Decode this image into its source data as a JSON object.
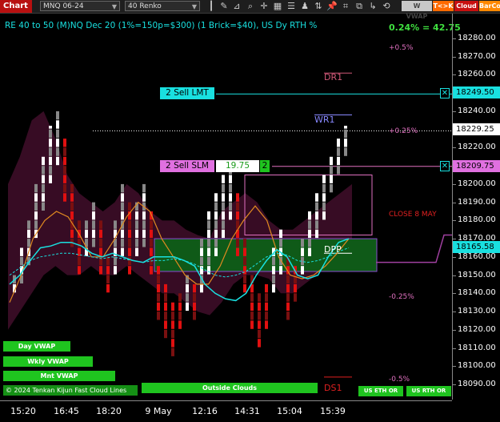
{
  "toolbar": {
    "chart_tab": "Chart",
    "instrument": "MNQ 06-24",
    "bar_type": "40 Renko",
    "btn_wvwap": "W VWAP",
    "btn_tk": "T<>K",
    "btn_cloud": "Cloud",
    "btn_barco": "BarCo"
  },
  "header": {
    "title": "RE 40 to 50 (M)NQ Dec 20 (1%=150p=$300) (1 Brick=$40), US Dy RTH %",
    "change": "0.24% = 42.75"
  },
  "y_axis": {
    "ticks": [
      "18280.00",
      "18270.00",
      "18260.00",
      "18250.00",
      "18240.00",
      "18230.00",
      "18220.00",
      "18210.00",
      "18200.00",
      "18190.00",
      "18180.00",
      "18170.00",
      "18160.00",
      "18150.00",
      "18140.00",
      "18130.00",
      "18120.00",
      "18110.00",
      "18100.00",
      "18090.00"
    ],
    "price_last": "18229.25",
    "price_lmt": "18249.50",
    "price_slm": "18209.75",
    "price_cur": "18165.58"
  },
  "x_axis": {
    "ticks": [
      "15:20",
      "16:45",
      "18:20",
      "9 May",
      "12:16",
      "14:31",
      "15:04",
      "15:39"
    ]
  },
  "levels": {
    "p05": "+0.5%",
    "dr1": "DR1",
    "wr1": "WR1",
    "p025": "+0.25%",
    "close": "CLOSE 8 MAY",
    "dpp": "DPP",
    "m025": "-0.25%",
    "m05": "-0.5%",
    "ds1": "DS1"
  },
  "orders": {
    "lmt_label": "2 Sell LMT",
    "slm_label": "2 Sell SLM",
    "slm_value": "19.75",
    "slm_qty": "2"
  },
  "indicators": {
    "day_vwap": "Day VWAP",
    "wkly_vwap": "Wkly VWAP",
    "mnt_vwap": "Mnt VWAP",
    "outside_clouds": "Outside Clouds",
    "us_eth_or": "US ETH OR",
    "us_rth_or": "US RTH OR",
    "footer_text": "© 2024 Tenkan Kijun Fast Cloud Lines"
  },
  "colors": {
    "up_brick": "#ffffff",
    "down_brick": "#e01010",
    "cyan": "#19e0e0",
    "orange": "#e08a20",
    "cloud": "#4a1030",
    "green_box": "#0f5a18",
    "pink": "#e070c0"
  },
  "chart_data": {
    "type": "renko",
    "y_range": [
      18084,
      18292
    ],
    "bricks_note": "column series",
    "columns": [
      {
        "dir": "up",
        "low": 18140,
        "high": 18150
      },
      {
        "dir": "up",
        "low": 18145,
        "high": 18165
      },
      {
        "dir": "up",
        "low": 18155,
        "high": 18180
      },
      {
        "dir": "up",
        "low": 18170,
        "high": 18200
      },
      {
        "dir": "up",
        "low": 18185,
        "high": 18215
      },
      {
        "dir": "up",
        "low": 18200,
        "high": 18232
      },
      {
        "dir": "up",
        "low": 18210,
        "high": 18240
      },
      {
        "dir": "down",
        "low": 18190,
        "high": 18225
      },
      {
        "dir": "down",
        "low": 18165,
        "high": 18200
      },
      {
        "dir": "down",
        "low": 18150,
        "high": 18180
      },
      {
        "dir": "up",
        "low": 18160,
        "high": 18180
      },
      {
        "dir": "up",
        "low": 18165,
        "high": 18190
      },
      {
        "dir": "down",
        "low": 18150,
        "high": 18180
      },
      {
        "dir": "down",
        "low": 18140,
        "high": 18160
      },
      {
        "dir": "up",
        "low": 18150,
        "high": 18180
      },
      {
        "dir": "up",
        "low": 18160,
        "high": 18200
      },
      {
        "dir": "down",
        "low": 18150,
        "high": 18190
      },
      {
        "dir": "up",
        "low": 18160,
        "high": 18190
      },
      {
        "dir": "up",
        "low": 18165,
        "high": 18200
      },
      {
        "dir": "down",
        "low": 18150,
        "high": 18185
      },
      {
        "dir": "down",
        "low": 18125,
        "high": 18155
      },
      {
        "dir": "down",
        "low": 18115,
        "high": 18145
      },
      {
        "dir": "down",
        "low": 18105,
        "high": 18135
      },
      {
        "dir": "down",
        "low": 18120,
        "high": 18140
      },
      {
        "dir": "up",
        "low": 18130,
        "high": 18150
      },
      {
        "dir": "down",
        "low": 18125,
        "high": 18145
      },
      {
        "dir": "up",
        "low": 18140,
        "high": 18170
      },
      {
        "dir": "up",
        "low": 18150,
        "high": 18185
      },
      {
        "dir": "up",
        "low": 18160,
        "high": 18195
      },
      {
        "dir": "up",
        "low": 18170,
        "high": 18205
      },
      {
        "dir": "up",
        "low": 18180,
        "high": 18210
      },
      {
        "dir": "down",
        "low": 18160,
        "high": 18195
      },
      {
        "dir": "down",
        "low": 18140,
        "high": 18170
      },
      {
        "dir": "down",
        "low": 18120,
        "high": 18150
      },
      {
        "dir": "down",
        "low": 18110,
        "high": 18140
      },
      {
        "dir": "down",
        "low": 18120,
        "high": 18145
      },
      {
        "dir": "up",
        "low": 18140,
        "high": 18165
      },
      {
        "dir": "up",
        "low": 18150,
        "high": 18175
      },
      {
        "dir": "down",
        "low": 18125,
        "high": 18160
      },
      {
        "dir": "down",
        "low": 18135,
        "high": 18155
      },
      {
        "dir": "up",
        "low": 18150,
        "high": 18170
      },
      {
        "dir": "up",
        "low": 18160,
        "high": 18185
      },
      {
        "dir": "up",
        "low": 18170,
        "high": 18195
      },
      {
        "dir": "up",
        "low": 18180,
        "high": 18205
      },
      {
        "dir": "up",
        "low": 18195,
        "high": 18215
      },
      {
        "dir": "up",
        "low": 18205,
        "high": 18225
      },
      {
        "dir": "up",
        "low": 18215,
        "high": 18232
      }
    ],
    "tenkan": [
      18145,
      18150,
      18158,
      18165,
      18166,
      18168,
      18168,
      18166,
      18162,
      18160,
      18162,
      18160,
      18158,
      18157,
      18160,
      18160,
      18160,
      18158,
      18155,
      18145,
      18140,
      18137,
      18136,
      18140,
      18150,
      18158,
      18164,
      18160,
      18150,
      18148,
      18150,
      18160,
      18168,
      18170
    ],
    "kijun": [
      18150,
      18154,
      18158,
      18160,
      18161,
      18162,
      18162,
      18161,
      18160,
      18159,
      18160,
      18159,
      18158,
      18157,
      18158,
      18158,
      18159,
      18158,
      18156,
      18153,
      18150,
      18149,
      18150,
      18152,
      18156,
      18160,
      18162,
      18161,
      18158,
      18157,
      18158,
      18160,
      18163,
      18165
    ],
    "orange_line": [
      18135,
      18150,
      18170,
      18180,
      18185,
      18182,
      18172,
      18160,
      18160,
      18170,
      18182,
      18190,
      18185,
      18170,
      18160,
      18150,
      18145,
      18145,
      18155,
      18170,
      18180,
      18188,
      18180,
      18160,
      18150,
      18148,
      18150,
      18155,
      18162,
      18170
    ]
  }
}
